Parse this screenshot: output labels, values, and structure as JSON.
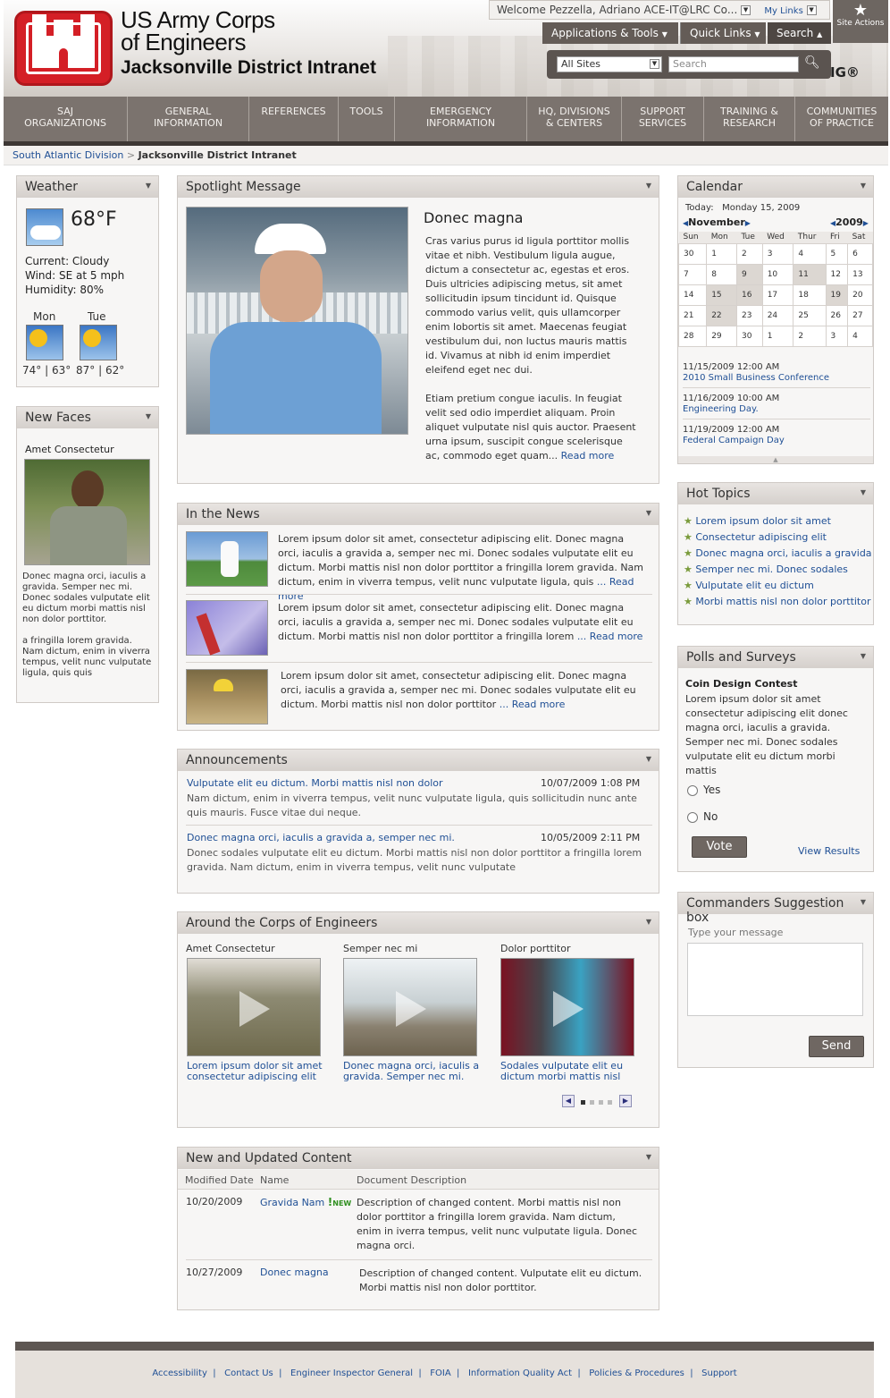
{
  "header": {
    "org_line1": "US Army Corps",
    "org_line2": "of Engineers",
    "site_title": "Jacksonville District Intranet",
    "welcome": "Welcome Pezzella, Adriano ACE-IT@LRC Co...",
    "my_links": "My Links",
    "site_actions": "Site Actions",
    "apps_tools": "Applications & Tools",
    "quick_links": "Quick Links",
    "search_tab": "Search",
    "scope": "All Sites",
    "search_placeholder": "Search",
    "brand_suffix": "IG®"
  },
  "nav": [
    "SAJ\nORGANIZATIONS",
    "GENERAL\nINFORMATION",
    "REFERENCES",
    "TOOLS",
    "EMERGENCY\nINFORMATION",
    "HQ, DIVISIONS\n& CENTERS",
    "SUPPORT\nSERVICES",
    "TRAINING &\nRESEARCH",
    "COMMUNITIES\nOF PRACTICE"
  ],
  "breadcrumb": {
    "parent": "South Atlantic Division",
    "sep": ">",
    "current": "Jacksonville District Intranet"
  },
  "weather": {
    "title": "Weather",
    "temp": "68°F",
    "current": "Current: Cloudy",
    "wind": "Wind: SE at 5 mph",
    "humidity": "Humidity: 80%",
    "d1": "Mon",
    "d1_range": "74° | 63°",
    "d2": "Tue",
    "d2_range": "87° | 62°"
  },
  "newfaces": {
    "title": "New Faces",
    "name": "Amet Consectetur",
    "text1": "Donec magna orci, iaculis a gravida.  Semper nec mi. Donec sodales vulputate elit eu dictum morbi mattis nisl non dolor porttitor.",
    "text2": "a fringilla lorem gravida. Nam dictum, enim in viverra tempus, velit nunc vulputate ligula, quis quis"
  },
  "spotlight": {
    "title": "Spotlight Message",
    "heading": "Donec magna",
    "p1": "Cras varius purus id ligula porttitor mollis vitae et nibh. Vestibulum ligula augue, dictum a consectetur ac, egestas et eros. Duis ultricies adipiscing metus, sit amet sollicitudin ipsum tincidunt id. Quisque commodo varius velit, quis ullamcorper enim lobortis sit amet. Maecenas feugiat vestibulum dui, non luctus mauris mattis id. Vivamus at nibh id enim imperdiet eleifend eget nec dui.",
    "p2": "Etiam pretium congue iaculis. In feugiat velit sed odio imperdiet aliquam. Proin aliquet vulputate nisl quis auctor. Praesent urna ipsum, suscipit congue scelerisque ac, commodo eget quam...",
    "more": "Read more"
  },
  "news": {
    "title": "In the News",
    "items": [
      {
        "text": "Lorem ipsum dolor sit amet, consectetur adipiscing elit. Donec magna orci, iaculis a gravida a, semper nec mi. Donec sodales vulputate elit eu dictum. Morbi mattis nisl non dolor porttitor a fringilla lorem gravida. Nam dictum, enim in viverra tempus, velit nunc vulputate ligula, quis",
        "more": "... Read more"
      },
      {
        "text": "Lorem ipsum dolor sit amet, consectetur adipiscing elit. Donec magna orci, iaculis a gravida a, semper nec mi. Donec sodales vulputate elit eu dictum. Morbi mattis nisl non dolor porttitor a fringilla lorem",
        "more": "... Read more"
      },
      {
        "text": "Lorem ipsum dolor sit amet, consectetur adipiscing elit. Donec magna orci, iaculis a gravida a, semper nec mi. Donec sodales vulputate elit eu dictum. Morbi mattis nisl non dolor porttitor",
        "more": "... Read more"
      }
    ]
  },
  "announcements": {
    "title": "Announcements",
    "items": [
      {
        "title": "Vulputate elit eu dictum. Morbi mattis nisl non dolor",
        "date": "10/07/2009 1:08 PM",
        "text": "Nam dictum, enim in viverra tempus, velit nunc vulputate ligula, quis sollicitudin nunc ante quis mauris. Fusce vitae dui neque."
      },
      {
        "title": "Donec magna orci, iaculis a gravida a, semper nec mi.",
        "date": "10/05/2009 2:11 PM",
        "text": "Donec sodales vulputate elit eu dictum. Morbi mattis nisl non dolor porttitor a fringilla lorem gravida. Nam dictum, enim in viverra tempus, velit nunc vulputate"
      }
    ]
  },
  "corps": {
    "title": "Around the Corps of Engineers",
    "items": [
      {
        "label": "Amet Consectetur",
        "caption": "Lorem ipsum dolor sit amet consectetur adipiscing elit"
      },
      {
        "label": "Semper nec mi",
        "caption": "Donec magna orci, iaculis a gravida.  Semper nec mi."
      },
      {
        "label": "Dolor porttitor",
        "caption": "Sodales vulputate elit eu dictum morbi mattis nisl"
      }
    ]
  },
  "content": {
    "title": "New and Updated Content",
    "col1": "Modified Date",
    "col2": "Name",
    "col3": "Document Description",
    "new_badge": "NEW",
    "rows": [
      {
        "date": "10/20/2009",
        "name": "Gravida Nam",
        "desc": "Description of changed content.  Morbi mattis nisl non dolor porttitor a fringilla lorem gravida.  Nam dictum, enim in iverra tempus, velit nunc vulputate ligula.  Donec magna orci."
      },
      {
        "date": "10/27/2009",
        "name": "Donec magna",
        "desc": "Description of changed content.  Vulputate elit eu dictum. Morbi  mattis nisl non dolor porttitor."
      }
    ]
  },
  "calendar": {
    "title": "Calendar",
    "today_label": "Today:",
    "today": "Monday 15, 2009",
    "month": "November",
    "year": "2009",
    "days": [
      "Sun",
      "Mon",
      "Tue",
      "Wed",
      "Thur",
      "Fri",
      "Sat"
    ],
    "weeks": [
      [
        "30",
        "1",
        "2",
        "3",
        "4",
        "5",
        "6"
      ],
      [
        "7",
        "8",
        "9",
        "10",
        "11",
        "12",
        "13"
      ],
      [
        "14",
        "15",
        "16",
        "17",
        "18",
        "19",
        "20"
      ],
      [
        "21",
        "22",
        "23",
        "24",
        "25",
        "26",
        "27"
      ],
      [
        "28",
        "29",
        "30",
        "1",
        "2",
        "3",
        "4"
      ]
    ],
    "events": [
      {
        "when": "11/15/2009  12:00 AM",
        "name": "2010 Small Business Conference"
      },
      {
        "when": "11/16/2009  10:00 AM",
        "name": "Engineering Day."
      },
      {
        "when": "11/19/2009  12:00 AM",
        "name": "Federal Campaign Day"
      }
    ]
  },
  "hot": {
    "title": "Hot Topics",
    "items": [
      "Lorem ipsum dolor sit amet",
      "Consectetur adipiscing elit",
      "Donec magna orci, iaculis a gravida",
      "Semper nec mi. Donec sodales",
      "Vulputate elit eu dictum",
      "Morbi mattis nisl non dolor porttitor"
    ]
  },
  "polls": {
    "title": "Polls and Surveys",
    "question": "Coin Design Contest",
    "text": "Lorem ipsum dolor sit amet consectetur adipiscing elit donec magna orci, iaculis a gravida. Semper nec mi. Donec sodales vulputate elit eu dictum morbi mattis",
    "yes": "Yes",
    "no": "No",
    "vote": "Vote",
    "results": "View Results"
  },
  "suggest": {
    "title": "Commanders Suggestion box",
    "placeholder": "Type your message",
    "send": "Send"
  },
  "footer": {
    "links": [
      "Accessibility",
      "Contact Us",
      "Engineer Inspector General",
      "FOIA",
      "Information Quality Act",
      "Policies & Procedures",
      "Support"
    ]
  }
}
